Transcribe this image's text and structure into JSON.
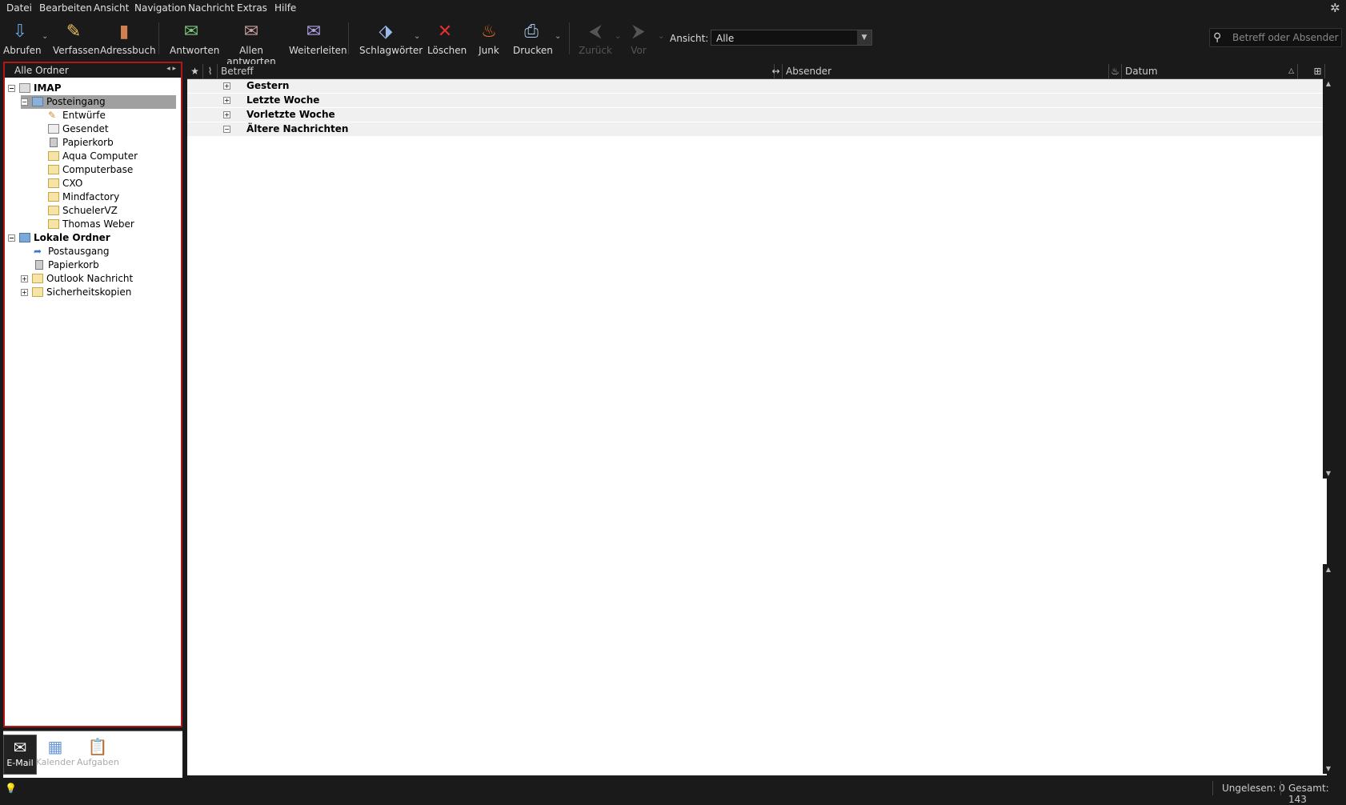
{
  "menubar": {
    "items": [
      "Datei",
      "Bearbeiten",
      "Ansicht",
      "Navigation",
      "Nachricht",
      "Extras",
      "Hilfe"
    ]
  },
  "toolbar": {
    "get_mail": "Abrufen",
    "compose": "Verfassen",
    "addressbook": "Adressbuch",
    "reply": "Antworten",
    "reply_all": "Allen antworten",
    "forward": "Weiterleiten",
    "tags": "Schlagwörter",
    "delete": "Löschen",
    "junk": "Junk",
    "print": "Drucken",
    "back": "Zurück",
    "forward_nav": "Vor",
    "view_label": "Ansicht:",
    "view_value": "Alle",
    "search_placeholder": "Betreff oder Absender"
  },
  "folder_pane": {
    "header": "Alle Ordner",
    "accounts": [
      {
        "name": "IMAP",
        "folders": [
          {
            "label": "Posteingang",
            "selected": true
          },
          {
            "label": "Entwürfe"
          },
          {
            "label": "Gesendet"
          },
          {
            "label": "Papierkorb"
          },
          {
            "label": "Aqua Computer"
          },
          {
            "label": "Computerbase"
          },
          {
            "label": "CXO"
          },
          {
            "label": "Mindfactory"
          },
          {
            "label": "SchuelerVZ"
          },
          {
            "label": "Thomas Weber"
          }
        ]
      },
      {
        "name": "Lokale Ordner",
        "folders": [
          {
            "label": "Postausgang"
          },
          {
            "label": "Papierkorb"
          },
          {
            "label": "Outlook Nachricht"
          },
          {
            "label": "Sicherheitskopien"
          }
        ]
      }
    ]
  },
  "bottom_nav": {
    "mail": "E-Mail",
    "calendar": "Kalender",
    "tasks": "Aufgaben"
  },
  "message_list": {
    "columns": {
      "subject": "Betreff",
      "sender": "Absender",
      "date": "Datum"
    },
    "groups": [
      "Gestern",
      "Letzte Woche",
      "Vorletzte Woche",
      "Ältere Nachrichten"
    ]
  },
  "status_bar": {
    "unread": "Ungelesen: 0",
    "total": "Gesamt: 143"
  },
  "colors": {
    "accent_border": "#b01818",
    "dark_chrome": "#1a1a1a"
  }
}
